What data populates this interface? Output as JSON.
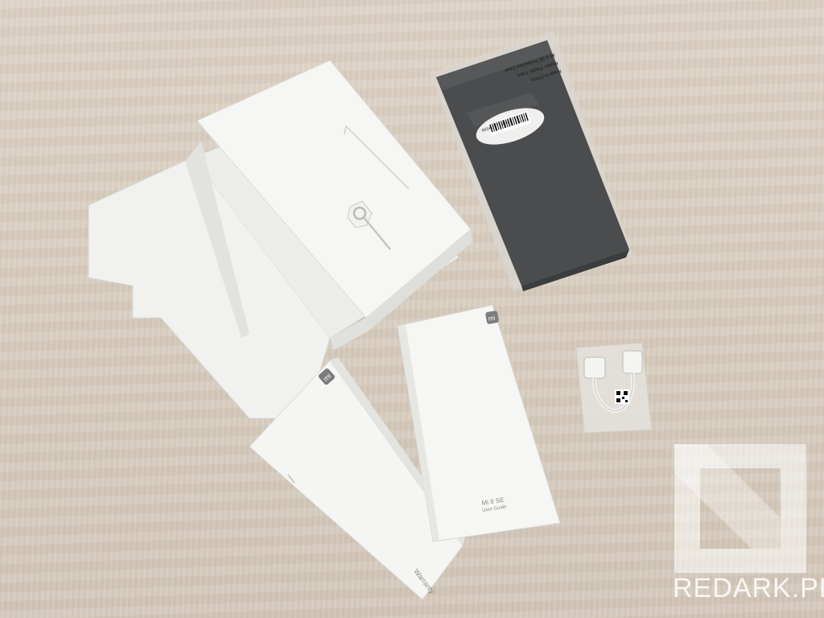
{
  "case_package": {
    "barcode_number": "6934177713033",
    "label_lines": [
      "Mi 9 SE Protective Case",
      "Model: Plastic Case",
      "Made in China"
    ]
  },
  "user_guide": {
    "product_name": "Mi 9 SE",
    "subtitle": "User Guide"
  },
  "warranty_card": {
    "label": "Warranty"
  },
  "watermark": {
    "text": "REDARK.PL"
  },
  "colors": {
    "table": "#d8cdbf",
    "paper": "#f4f4f2",
    "case": "#4a4c4d",
    "watermark": "#ffffff"
  }
}
